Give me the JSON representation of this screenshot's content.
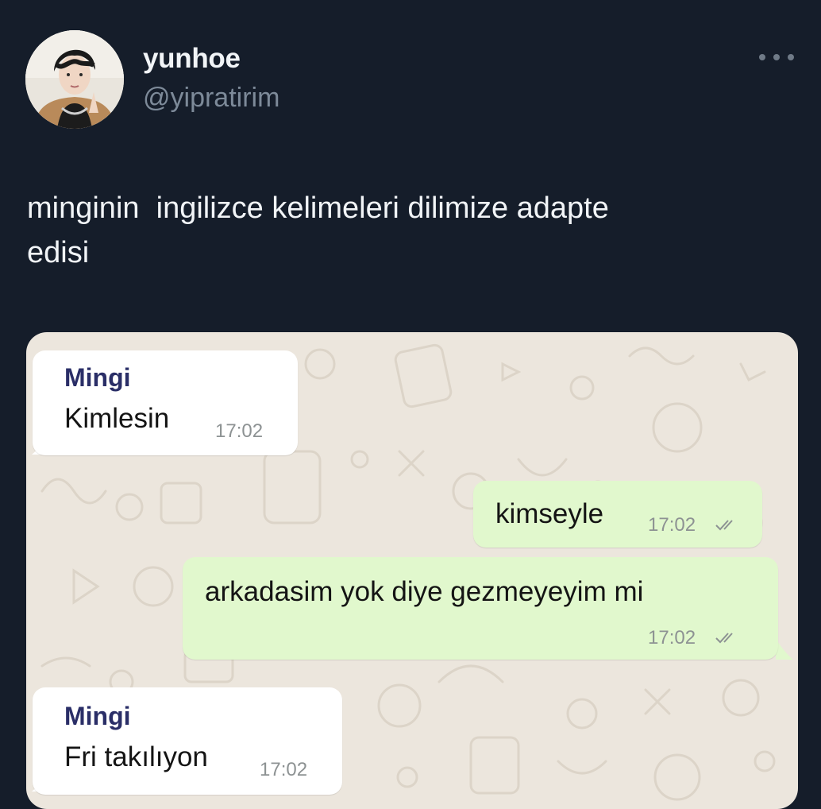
{
  "tweet": {
    "author_name": "yunhoe",
    "author_handle": "@yipratirim",
    "text": "minginin  ingilizce kelimeleri dilimize adapte\nedisi",
    "more_icon": "more-dots-icon"
  },
  "chat": {
    "messages": [
      {
        "direction": "incoming",
        "sender": "Mingi",
        "text": "Kimlesin",
        "time": "17:02"
      },
      {
        "direction": "outgoing",
        "text": "kimseyle",
        "time": "17:02",
        "status_icon": "double-check-icon"
      },
      {
        "direction": "outgoing",
        "text": "arkadasim yok diye gezmeyeyim mi",
        "time": "17:02",
        "status_icon": "double-check-icon"
      },
      {
        "direction": "incoming",
        "sender": "Mingi",
        "text": "Fri takılıyon",
        "time": "17:02"
      }
    ]
  },
  "colors": {
    "background": "#151d2a",
    "incoming_bubble": "#ffffff",
    "outgoing_bubble": "#e1f8cd",
    "sender_name": "#2a2e67",
    "chat_wallpaper": "#ece6dd"
  }
}
